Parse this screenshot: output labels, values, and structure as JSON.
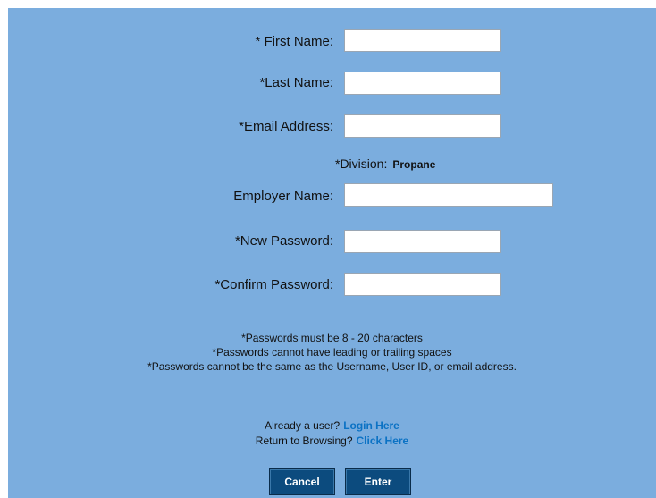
{
  "form": {
    "first_name": {
      "label": "* First Name:",
      "value": ""
    },
    "last_name": {
      "label": "*Last Name:",
      "value": ""
    },
    "email": {
      "label": "*Email Address:",
      "value": ""
    },
    "division": {
      "label": "*Division:",
      "value": "Propane"
    },
    "employer": {
      "label": "Employer Name:",
      "value": ""
    },
    "new_password": {
      "label": "*New Password:",
      "value": ""
    },
    "confirm_password": {
      "label": "*Confirm Password:",
      "value": ""
    }
  },
  "notes": [
    "*Passwords must be 8 - 20 characters",
    "*Passwords cannot have leading or trailing spaces",
    "*Passwords cannot be the same as the Username, User ID, or email address."
  ],
  "links": {
    "login_prompt": "Already a user?",
    "login_link": "Login Here",
    "browse_prompt": "Return to Browsing?",
    "browse_link": "Click Here"
  },
  "buttons": {
    "cancel": "Cancel",
    "enter": "Enter"
  },
  "colors": {
    "panel_bg": "#7badde",
    "link": "#0b72c4",
    "button_bg": "#0c4b7e"
  }
}
